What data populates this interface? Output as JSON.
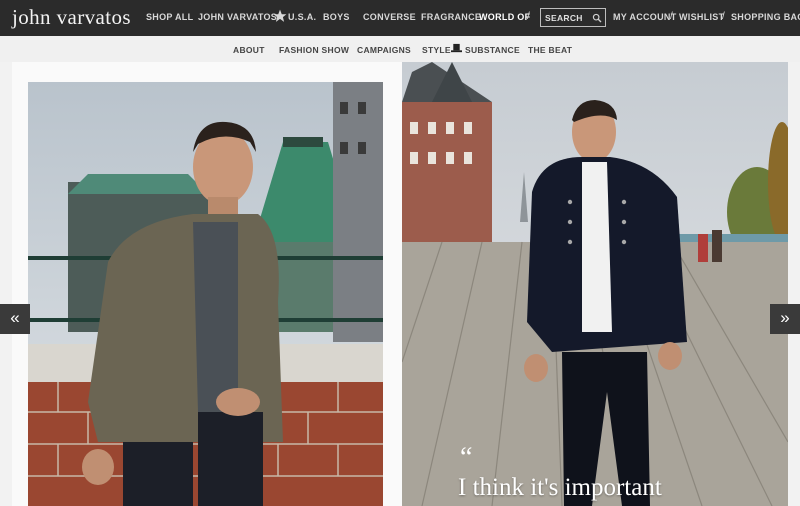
{
  "brand": {
    "logo_text": "john varvatos"
  },
  "top_nav": {
    "items": [
      "SHOP ALL",
      "JOHN VARVATOS",
      "U.S.A.",
      "BOYS",
      "CONVERSE",
      "FRAGRANCE",
      "WORLD OF"
    ],
    "active": "WORLD OF",
    "separator": "/",
    "search_placeholder": "SEARCH",
    "account": "MY ACCOUNT",
    "wishlist": "WISHLIST",
    "bag": "SHOPPING BAG"
  },
  "sub_nav": {
    "items": [
      "ABOUT",
      "FASHION SHOW",
      "CAMPAIGNS",
      "STYLE",
      "SUBSTANCE",
      "THE BEAT"
    ]
  },
  "carousel": {
    "prev_label": "«",
    "next_label": "»",
    "quote_mark": "“",
    "quote_text": "I think it's important"
  },
  "colors": {
    "topbar": "#2b2b2b",
    "subnav": "#f0f0f0",
    "page": "#fafafa"
  }
}
